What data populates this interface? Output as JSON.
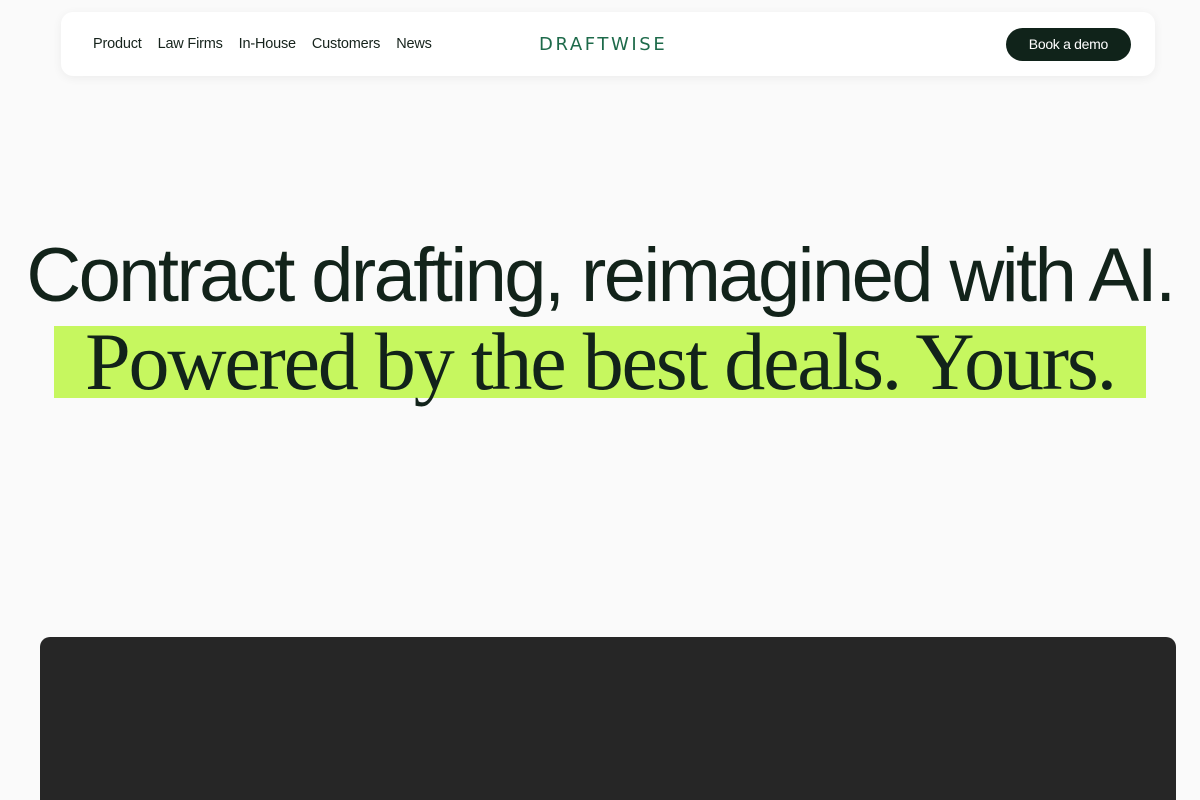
{
  "nav": {
    "links": [
      "Product",
      "Law Firms",
      "In-House",
      "Customers",
      "News"
    ],
    "logo": "DRAFTWISE",
    "cta_label": "Book a demo"
  },
  "hero": {
    "headline": "Contract drafting, reimagined with AI.",
    "subline": "Powered by the best deals. Yours."
  },
  "colors": {
    "brand_green": "#1d6a4a",
    "highlight": "#c6f75f",
    "dark": "#10231a",
    "media_bg": "#262626"
  }
}
